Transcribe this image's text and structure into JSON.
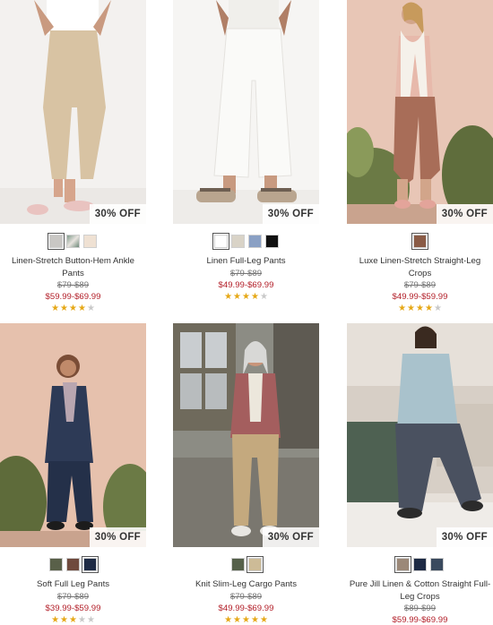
{
  "products": [
    {
      "badge": "30% OFF",
      "name": "Linen-Stretch Button-Hem Ankle Pants",
      "original_price": "$79-$89",
      "sale_price": "$59.99-$69.99",
      "rating": 4,
      "swatches": [
        "#c9c7c4",
        "#7f9a8a",
        "#efe1d3"
      ],
      "bg": "#f4f2f0",
      "garment": "#d8c3a3"
    },
    {
      "badge": "30% OFF",
      "name": "Linen Full-Leg Pants",
      "original_price": "$79-$89",
      "sale_price": "$49.99-$69.99",
      "rating": 4,
      "swatches": [
        "#ffffff",
        "#d9d3c7",
        "#8aa0c4",
        "#111111"
      ],
      "bg": "#f5f4f2",
      "garment": "#f3f2ee"
    },
    {
      "badge": "30% OFF",
      "name": "Luxe Linen-Stretch Straight-Leg Crops",
      "original_price": "$79-$89",
      "sale_price": "$49.99-$59.99",
      "rating": 4,
      "swatches": [
        "#8a5b46"
      ],
      "bg": "#e9c8b8",
      "garment": "#a86d58"
    },
    {
      "badge": "30% OFF",
      "name": "Soft Full Leg Pants",
      "original_price": "$79-$89",
      "sale_price": "$39.99-$59.99",
      "rating": 3,
      "swatches": [
        "#596049",
        "#6f4a3d",
        "#1e2a44"
      ],
      "bg": "#e7c2ae",
      "garment": "#243049"
    },
    {
      "badge": "30% OFF",
      "name": "Knit Slim-Leg Cargo Pants",
      "original_price": "$79-$89",
      "sale_price": "$49.99-$69.99",
      "rating": 5,
      "swatches": [
        "#55604a",
        "#cdbb97"
      ],
      "bg": "#8f8f88",
      "garment": "#c4a97e"
    },
    {
      "badge": "30% OFF",
      "name": "Pure Jill Linen & Cotton Straight Full-Leg Crops",
      "original_price": "$89-$99",
      "sale_price": "$59.99-$69.99",
      "rating": 4,
      "swatches": [
        "#9b8878",
        "#1d2a44",
        "#3a4a5e"
      ],
      "bg": "#e8e2dc",
      "garment": "#4a5160"
    }
  ],
  "colors": {
    "sale": "#b3202a",
    "star": "#e6a817"
  }
}
